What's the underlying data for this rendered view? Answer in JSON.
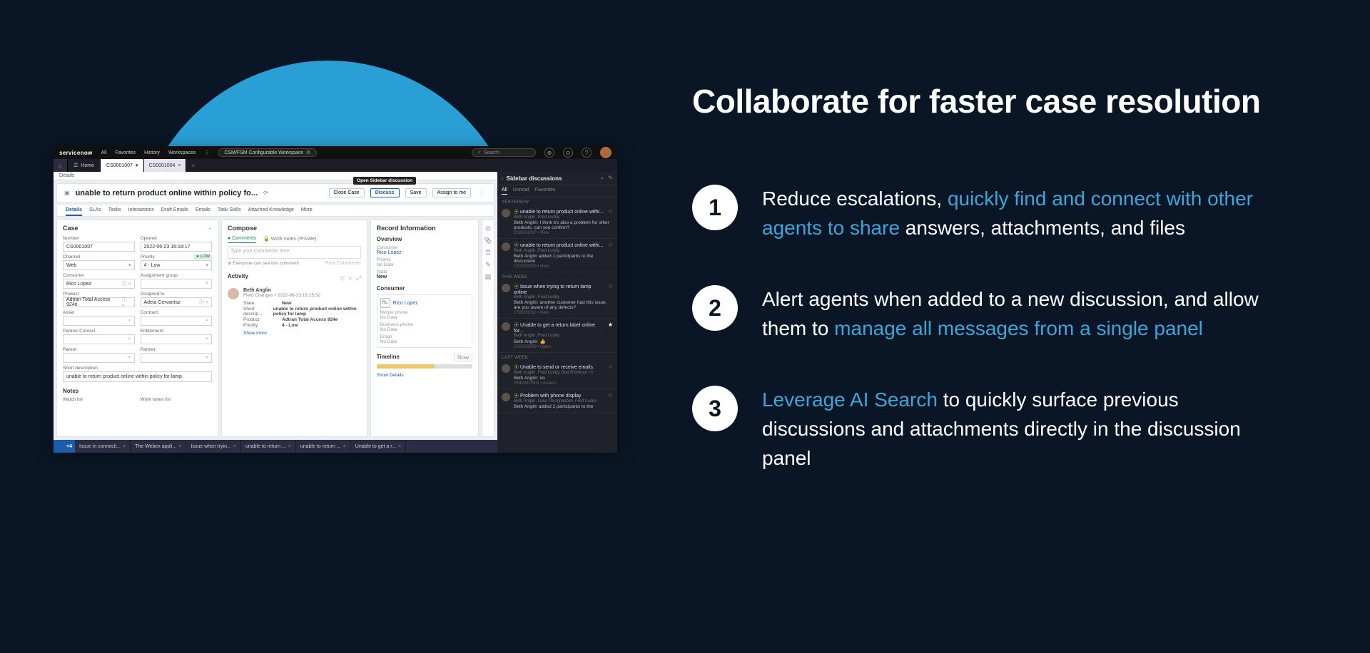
{
  "marketing": {
    "headline": "Collaborate for faster case resolution",
    "features": [
      {
        "num": "1",
        "plain1": "Reduce escalations, ",
        "hl": "quickly find and connect with other agents to share",
        "plain2": " answers, attachments, and files"
      },
      {
        "num": "2",
        "plain1": "Alert agents when added to a new discussion, and allow them to ",
        "hl": "manage all messages from a single panel",
        "plain2": ""
      },
      {
        "num": "3",
        "hl": "Leverage AI Search",
        "plain1": "",
        "plain2": " to quickly surface previous discussions and attachments directly in the discussion panel"
      }
    ]
  },
  "topbar": {
    "logo": "servicenow",
    "nav": [
      "All",
      "Favorites",
      "History",
      "Workspaces"
    ],
    "workspace": "CSM/FSM Configurable Workspace",
    "search_placeholder": "Search"
  },
  "tabs": {
    "home": "Home",
    "t1": "CS0001007",
    "t2": "CS0001004"
  },
  "details_tab": "Details",
  "record": {
    "title": "unable to return product online within policy fo...",
    "actions": {
      "close": "Close Case",
      "discuss": "Discuss",
      "save": "Save",
      "assign": "Assign to me"
    },
    "tooltip": "Open Sidebar discussion",
    "tabs": [
      "Details",
      "SLAs",
      "Tasks",
      "Interactions",
      "Draft Emails",
      "Emails",
      "Task Skills",
      "Attached Knowledge",
      "More"
    ]
  },
  "case": {
    "heading": "Case",
    "number_label": "Number",
    "number": "CS0001007",
    "opened_label": "Opened",
    "opened": "2022-06-23 16:18:17",
    "channel_label": "Channel",
    "channel": "Web",
    "priority_label": "Priority",
    "priority": "4 - Low",
    "priority_badge": "● LOW",
    "consumer_label": "Consumer",
    "consumer": "Rico Lopez",
    "assign_grp_label": "Assignment group",
    "assign_grp": "",
    "product_label": "Product",
    "product": "Adtran Total Access 924e",
    "assigned_label": "Assigned to",
    "assigned": "Adela Cervantsz",
    "asset_label": "Asset",
    "asset": "",
    "contact_label": "Contract",
    "contact": "",
    "partner_contact_label": "Partner Contact",
    "partner_contact": "",
    "entitlement_label": "Entitlement",
    "entitlement": "",
    "parent_label": "Parent",
    "parent": "",
    "partner_label": "Partner",
    "partner": "",
    "short_desc_label": "Short description",
    "short_desc": "unable to return product online within policy for lamp",
    "notes": "Notes",
    "watch_label": "Watch list",
    "worknotes_label": "Work notes list"
  },
  "compose": {
    "heading": "Compose",
    "tab_comments": "Comments",
    "tab_worknotes": "Work notes (Private)",
    "placeholder": "Type your Comments here",
    "visibility": "Everyone can see this comment",
    "post": "Post Comments"
  },
  "activity": {
    "heading": "Activity",
    "name": "Beth Anglin",
    "meta": "Field Changes • 2022-06-23 16:25:32",
    "rows": [
      {
        "k": "State",
        "v": "New"
      },
      {
        "k": "Short descrip...",
        "v": "unable to return product online within policy for lamp"
      },
      {
        "k": "Product",
        "v": "Adtran Total Access 924e"
      },
      {
        "k": "Priority",
        "v": "4 - Low"
      }
    ],
    "showmore": "Show more"
  },
  "rinfo": {
    "heading": "Record Information",
    "overview": "Overview",
    "consumer_label": "Consumer",
    "consumer": "Rico Lopez",
    "priority_label": "Priority",
    "priority": "No Data",
    "state_label": "State",
    "state": "New",
    "consumer_h": "Consumer",
    "consumer_name": "Rico Lopez",
    "rl": "RL",
    "mobile_label": "Mobile phone",
    "mobile": "No Data",
    "bphone_label": "Business phone",
    "bphone": "No Data",
    "email_label": "Email",
    "email": "No Data",
    "timeline": "Timeline",
    "tl_now": "Now",
    "showdetails": "Show Details"
  },
  "footer": {
    "count": "+4",
    "tabs": [
      "Issue in connecti...",
      "The Webex appli...",
      "Issue when tryin...",
      "unable to return ...",
      "unable to return ...",
      "Unable to get a r..."
    ]
  },
  "sidebar": {
    "title": "Sidebar discussions",
    "tabs": [
      "All",
      "Unread",
      "Favorites"
    ],
    "groups": [
      {
        "label": "YESTERDAY",
        "items": [
          {
            "title": "unable to return product online withi...",
            "sub": "Beth Anglin, Fred Luddy",
            "msg": "Beth Anglin: I think it's also a problem for other products, can you confirm?",
            "meta": "CS0001007 • New",
            "star": false
          },
          {
            "title": "unable to return product online withi...",
            "sub": "Beth Anglin, Fred Luddy",
            "msg": "Beth Anglin added 1 participants to the discussion",
            "meta": "CS0001009 • New",
            "star": false
          }
        ]
      },
      {
        "label": "THIS WEEK",
        "items": [
          {
            "title": "Issue when trying to return lamp online",
            "sub": "Beth Anglin, Fred Luddy",
            "msg": "Beth Anglin: another customer had this issue, are you aware of any defects?",
            "meta": "CS0001010 • New",
            "star": false
          },
          {
            "title": "Unable to get a return label online for...",
            "sub": "Beth Anglin, Fred Luddy",
            "msg": "Beth Anglin: 👍",
            "meta": "CS0001009 • Open",
            "star": true
          }
        ]
      },
      {
        "label": "LAST WEEK",
        "items": [
          {
            "title": "Unable to send or receive emails.",
            "sub": "Beth Anglin, Fred Luddy, Bud Richman +1",
            "msg": "Beth Anglin: no",
            "meta": "PRB0007601 • Assess",
            "star": false
          },
          {
            "title": "Problem with phone display",
            "sub": "Beth Anglin, Luke Throgmorton, Fred Ludes",
            "msg": "Beth Anglin added 2 participants to the",
            "meta": "",
            "star": false
          }
        ]
      }
    ]
  }
}
